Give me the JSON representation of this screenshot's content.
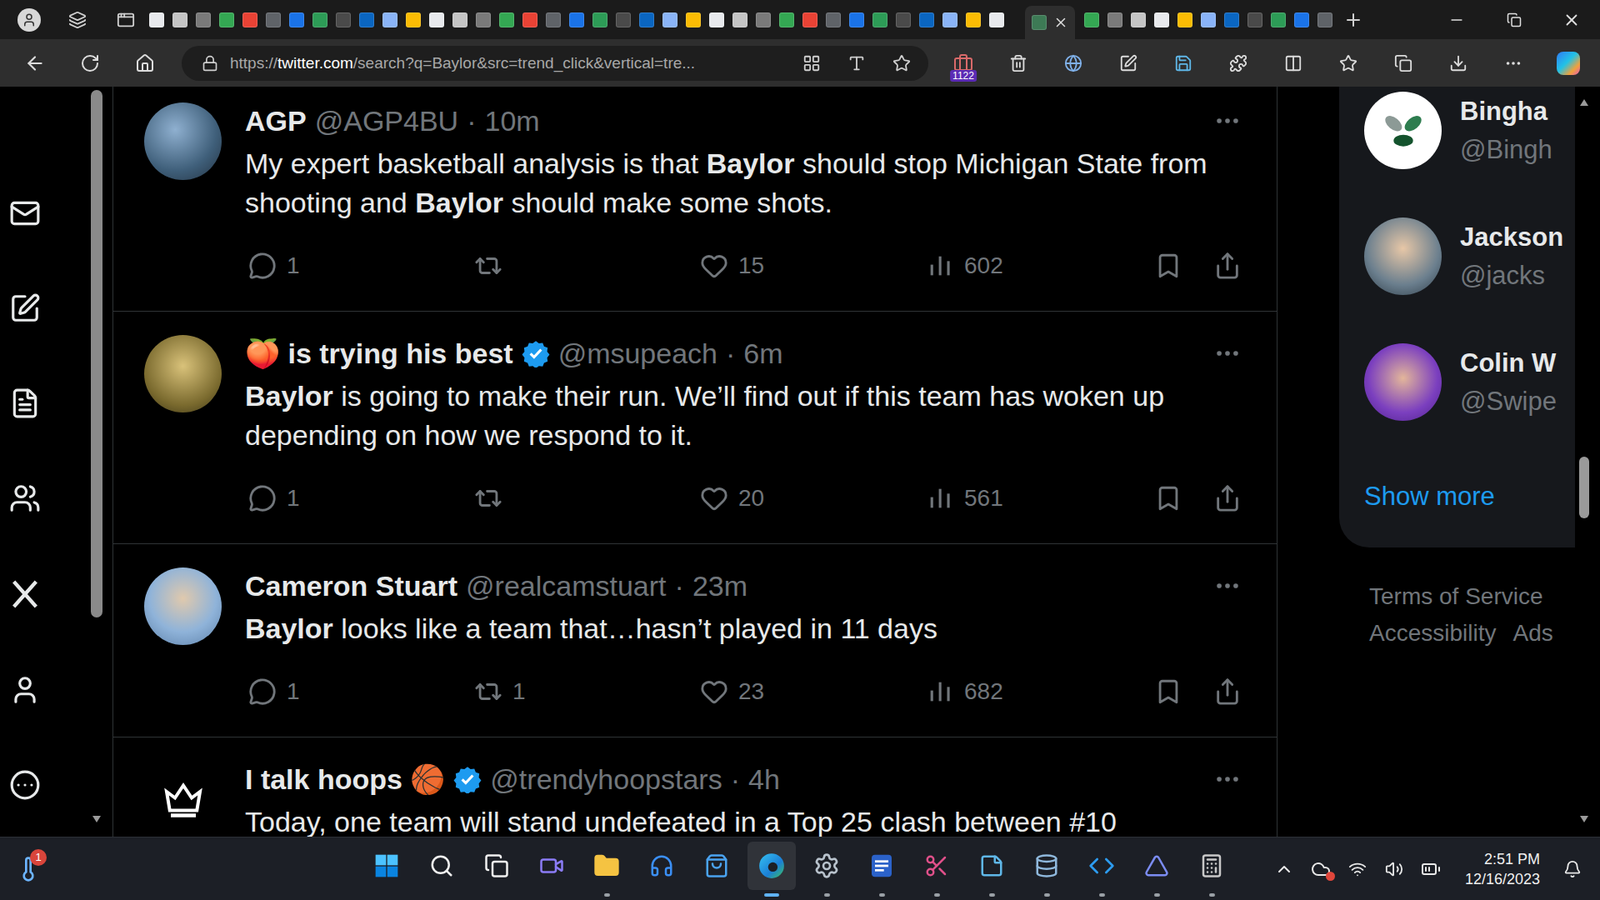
{
  "browser": {
    "url_scheme": "https://",
    "url_host": "twitter.com",
    "url_path": "/search?q=Baylor&src=trend_click&vertical=tre...",
    "extension_badge": "1122"
  },
  "separator": "·",
  "tweets": [
    {
      "name": "AGP",
      "verified": false,
      "handle": "@AGP4BU",
      "time": "10m",
      "text": [
        {
          "text": "My expert basketball analysis is that ",
          "bold": false
        },
        {
          "text": "Baylor",
          "bold": true
        },
        {
          "text": " should stop Michigan State from shooting and ",
          "bold": false
        },
        {
          "text": "Baylor",
          "bold": true
        },
        {
          "text": " should make some shots.",
          "bold": false
        }
      ],
      "replies": "1",
      "retweets": "",
      "likes": "15",
      "views": "602"
    },
    {
      "name": "🍑 is trying his best",
      "verified": true,
      "handle": "@msupeach",
      "time": "6m",
      "text": [
        {
          "text": "Baylor",
          "bold": true
        },
        {
          "text": " is going to make their run. We’ll find out if this team has woken up depending on how we respond to it.",
          "bold": false
        }
      ],
      "replies": "1",
      "retweets": "",
      "likes": "20",
      "views": "561"
    },
    {
      "name": "Cameron Stuart",
      "verified": false,
      "handle": "@realcamstuart",
      "time": "23m",
      "text": [
        {
          "text": "Baylor",
          "bold": true
        },
        {
          "text": " looks like a team that…hasn’t played in 11 days",
          "bold": false
        }
      ],
      "replies": "1",
      "retweets": "1",
      "likes": "23",
      "views": "682"
    },
    {
      "name": "I talk hoops 🏀",
      "verified": true,
      "handle": "@trendyhoopstars",
      "time": "4h",
      "text": [
        {
          "text": "Today, one team will stand undefeated in a Top 25 clash between #10",
          "bold": false
        }
      ]
    }
  ],
  "who_to_follow": {
    "accounts": [
      {
        "name": "Bingha",
        "handle": "@Bingh"
      },
      {
        "name": "Jackson",
        "handle": "@jacks"
      },
      {
        "name": "Colin W",
        "handle": "@Swipe"
      }
    ],
    "show_more": "Show more"
  },
  "footer_links": [
    "Terms of Service",
    "Accessibility",
    "Ads"
  ],
  "taskbar": {
    "notification_badge": "1",
    "time": "2:51 PM",
    "date": "12/16/2023",
    "apps": [
      {
        "running": false,
        "active": false
      },
      {
        "running": false,
        "active": false
      },
      {
        "running": false,
        "active": false
      },
      {
        "running": false,
        "active": false
      },
      {
        "running": true,
        "active": false
      },
      {
        "running": false,
        "active": false
      },
      {
        "running": false,
        "active": false
      },
      {
        "running": true,
        "active": true
      },
      {
        "running": true,
        "active": false
      },
      {
        "running": true,
        "active": false
      },
      {
        "running": true,
        "active": false
      },
      {
        "running": true,
        "active": false
      },
      {
        "running": true,
        "active": false
      },
      {
        "running": true,
        "active": false
      },
      {
        "running": true,
        "active": false
      },
      {
        "running": true,
        "active": false
      }
    ]
  }
}
